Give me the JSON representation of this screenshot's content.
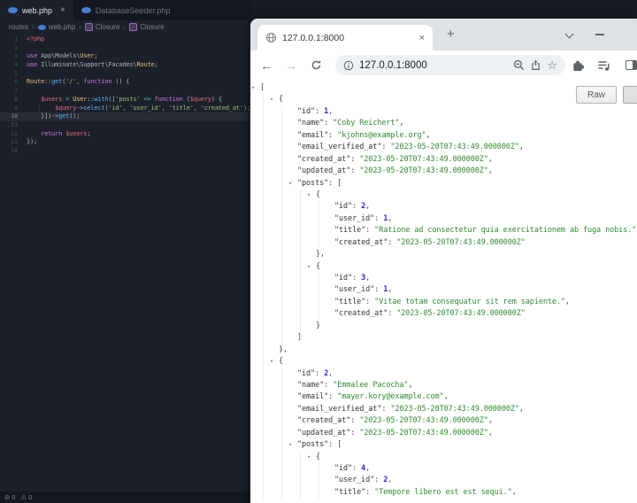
{
  "icons": {
    "close": "×",
    "plus": "+",
    "back": "←",
    "forward": "→",
    "star": "☆",
    "expander": "▾",
    "crumb_sep": "›",
    "error": "⊘",
    "warning": "⚠"
  },
  "editor": {
    "tabs": [
      {
        "label": "web.php"
      },
      {
        "label": "DatabaseSeeder.php"
      }
    ],
    "breadcrumb": [
      "routes",
      "web.php",
      "Closure",
      "Closure"
    ],
    "status": {
      "errors": "0",
      "warnings": "0"
    },
    "code_lines": [
      {
        "n": 1,
        "segs": [
          [
            "red",
            "<?php"
          ]
        ]
      },
      {
        "n": 2,
        "segs": []
      },
      {
        "n": 3,
        "segs": [
          [
            "purple",
            "use "
          ],
          [
            "fg",
            "App\\Models\\"
          ],
          [
            "yellow",
            "User"
          ],
          [
            "fg",
            ";"
          ]
        ]
      },
      {
        "n": 4,
        "segs": [
          [
            "purple",
            "use "
          ],
          [
            "fg",
            "Illuminate\\Support\\Facades\\"
          ],
          [
            "yellow",
            "Route"
          ],
          [
            "fg",
            ";"
          ]
        ]
      },
      {
        "n": 5,
        "segs": []
      },
      {
        "n": 6,
        "segs": [
          [
            "yellow",
            "Route"
          ],
          [
            "fg",
            "::"
          ],
          [
            "blue",
            "get"
          ],
          [
            "fg",
            "("
          ],
          [
            "green",
            "'/'"
          ],
          [
            "fg",
            ", "
          ],
          [
            "purple",
            "function"
          ],
          [
            "fg",
            " () {"
          ]
        ]
      },
      {
        "n": 7,
        "segs": []
      },
      {
        "n": 8,
        "segs": [
          [
            "fg",
            "    "
          ],
          [
            "red",
            "$users"
          ],
          [
            "fg",
            " "
          ],
          [
            "cyan",
            "="
          ],
          [
            "fg",
            " "
          ],
          [
            "yellow",
            "User"
          ],
          [
            "fg",
            "::"
          ],
          [
            "blue",
            "with"
          ],
          [
            "fg",
            "(["
          ],
          [
            "green",
            "'posts'"
          ],
          [
            "fg",
            " "
          ],
          [
            "cyan",
            "=>"
          ],
          [
            "fg",
            " "
          ],
          [
            "purple",
            "function"
          ],
          [
            "fg",
            " ("
          ],
          [
            "red",
            "$query"
          ],
          [
            "fg",
            ") {"
          ]
        ]
      },
      {
        "n": 9,
        "guide": true,
        "segs": [
          [
            "fg",
            "        "
          ],
          [
            "red",
            "$query"
          ],
          [
            "fg",
            "->"
          ],
          [
            "blue",
            "select"
          ],
          [
            "fg",
            "("
          ],
          [
            "green",
            "'id'"
          ],
          [
            "fg",
            ", "
          ],
          [
            "green",
            "'user_id'"
          ],
          [
            "fg",
            ", "
          ],
          [
            "green",
            "'title'"
          ],
          [
            "fg",
            ", "
          ],
          [
            "green",
            "'created_at'"
          ],
          [
            "fg",
            ");"
          ]
        ]
      },
      {
        "n": 10,
        "active": true,
        "segs": [
          [
            "fg",
            "    }])->"
          ],
          [
            "blue",
            "get"
          ],
          [
            "fg",
            "();"
          ]
        ]
      },
      {
        "n": 11,
        "segs": []
      },
      {
        "n": 12,
        "segs": [
          [
            "fg",
            "    "
          ],
          [
            "purple",
            "return "
          ],
          [
            "red",
            "$users"
          ],
          [
            "fg",
            ";"
          ]
        ]
      },
      {
        "n": 13,
        "segs": [
          [
            "fg",
            "});"
          ]
        ]
      },
      {
        "n": 14,
        "segs": []
      }
    ]
  },
  "browser": {
    "tab_title": "127.0.0.1:8000",
    "url": "127.0.0.1:8000",
    "raw_button": "Raw",
    "json_lines": [
      {
        "ind": 0,
        "exp": true,
        "segs": [
          [
            "p",
            "["
          ]
        ]
      },
      {
        "ind": 1,
        "exp": true,
        "segs": [
          [
            "p",
            "{"
          ]
        ]
      },
      {
        "ind": 2,
        "segs": [
          [
            "k",
            "\"id\""
          ],
          [
            "p",
            ": "
          ],
          [
            "n",
            "1"
          ],
          [
            "p",
            ","
          ]
        ]
      },
      {
        "ind": 2,
        "segs": [
          [
            "k",
            "\"name\""
          ],
          [
            "p",
            ": "
          ],
          [
            "s",
            "\"Coby Reichert\""
          ],
          [
            "p",
            ","
          ]
        ]
      },
      {
        "ind": 2,
        "segs": [
          [
            "k",
            "\"email\""
          ],
          [
            "p",
            ": "
          ],
          [
            "s",
            "\"kjohns@example.org\""
          ],
          [
            "p",
            ","
          ]
        ]
      },
      {
        "ind": 2,
        "segs": [
          [
            "k",
            "\"email_verified_at\""
          ],
          [
            "p",
            ": "
          ],
          [
            "s",
            "\"2023-05-20T07:43:49.000000Z\""
          ],
          [
            "p",
            ","
          ]
        ]
      },
      {
        "ind": 2,
        "segs": [
          [
            "k",
            "\"created_at\""
          ],
          [
            "p",
            ": "
          ],
          [
            "s",
            "\"2023-05-20T07:43:49.000000Z\""
          ],
          [
            "p",
            ","
          ]
        ]
      },
      {
        "ind": 2,
        "segs": [
          [
            "k",
            "\"updated_at\""
          ],
          [
            "p",
            ": "
          ],
          [
            "s",
            "\"2023-05-20T07:43:49.000000Z\""
          ],
          [
            "p",
            ","
          ]
        ]
      },
      {
        "ind": 2,
        "exp": true,
        "segs": [
          [
            "k",
            "\"posts\""
          ],
          [
            "p",
            ": ["
          ]
        ]
      },
      {
        "ind": 3,
        "exp": true,
        "segs": [
          [
            "p",
            "{"
          ]
        ]
      },
      {
        "ind": 4,
        "segs": [
          [
            "k",
            "\"id\""
          ],
          [
            "p",
            ": "
          ],
          [
            "n",
            "2"
          ],
          [
            "p",
            ","
          ]
        ]
      },
      {
        "ind": 4,
        "segs": [
          [
            "k",
            "\"user_id\""
          ],
          [
            "p",
            ": "
          ],
          [
            "n",
            "1"
          ],
          [
            "p",
            ","
          ]
        ]
      },
      {
        "ind": 4,
        "segs": [
          [
            "k",
            "\"title\""
          ],
          [
            "p",
            ": "
          ],
          [
            "s",
            "\"Ratione ad consectetur quia exercitationem ab fuga nobis.\""
          ],
          [
            "p",
            ","
          ]
        ]
      },
      {
        "ind": 4,
        "segs": [
          [
            "k",
            "\"created_at\""
          ],
          [
            "p",
            ": "
          ],
          [
            "s",
            "\"2023-05-20T07:43:49.000000Z\""
          ]
        ]
      },
      {
        "ind": 3,
        "segs": [
          [
            "p",
            "},"
          ]
        ]
      },
      {
        "ind": 3,
        "exp": true,
        "segs": [
          [
            "p",
            "{"
          ]
        ]
      },
      {
        "ind": 4,
        "segs": [
          [
            "k",
            "\"id\""
          ],
          [
            "p",
            ": "
          ],
          [
            "n",
            "3"
          ],
          [
            "p",
            ","
          ]
        ]
      },
      {
        "ind": 4,
        "segs": [
          [
            "k",
            "\"user_id\""
          ],
          [
            "p",
            ": "
          ],
          [
            "n",
            "1"
          ],
          [
            "p",
            ","
          ]
        ]
      },
      {
        "ind": 4,
        "segs": [
          [
            "k",
            "\"title\""
          ],
          [
            "p",
            ": "
          ],
          [
            "s",
            "\"Vitae totam consequatur sit rem sapiente.\""
          ],
          [
            "p",
            ","
          ]
        ]
      },
      {
        "ind": 4,
        "segs": [
          [
            "k",
            "\"created_at\""
          ],
          [
            "p",
            ": "
          ],
          [
            "s",
            "\"2023-05-20T07:43:49.000000Z\""
          ]
        ]
      },
      {
        "ind": 3,
        "segs": [
          [
            "p",
            "}"
          ]
        ]
      },
      {
        "ind": 2,
        "segs": [
          [
            "p",
            "]"
          ]
        ]
      },
      {
        "ind": 1,
        "segs": [
          [
            "p",
            "},"
          ]
        ]
      },
      {
        "ind": 1,
        "exp": true,
        "segs": [
          [
            "p",
            "{"
          ]
        ]
      },
      {
        "ind": 2,
        "segs": [
          [
            "k",
            "\"id\""
          ],
          [
            "p",
            ": "
          ],
          [
            "n",
            "2"
          ],
          [
            "p",
            ","
          ]
        ]
      },
      {
        "ind": 2,
        "segs": [
          [
            "k",
            "\"name\""
          ],
          [
            "p",
            ": "
          ],
          [
            "s",
            "\"Emmalee Pacocha\""
          ],
          [
            "p",
            ","
          ]
        ]
      },
      {
        "ind": 2,
        "segs": [
          [
            "k",
            "\"email\""
          ],
          [
            "p",
            ": "
          ],
          [
            "s",
            "\"mayer.kory@example.com\""
          ],
          [
            "p",
            ","
          ]
        ]
      },
      {
        "ind": 2,
        "segs": [
          [
            "k",
            "\"email_verified_at\""
          ],
          [
            "p",
            ": "
          ],
          [
            "s",
            "\"2023-05-20T07:43:49.000000Z\""
          ],
          [
            "p",
            ","
          ]
        ]
      },
      {
        "ind": 2,
        "segs": [
          [
            "k",
            "\"created_at\""
          ],
          [
            "p",
            ": "
          ],
          [
            "s",
            "\"2023-05-20T07:43:49.000000Z\""
          ],
          [
            "p",
            ","
          ]
        ]
      },
      {
        "ind": 2,
        "segs": [
          [
            "k",
            "\"updated_at\""
          ],
          [
            "p",
            ": "
          ],
          [
            "s",
            "\"2023-05-20T07:43:49.000000Z\""
          ],
          [
            "p",
            ","
          ]
        ]
      },
      {
        "ind": 2,
        "exp": true,
        "segs": [
          [
            "k",
            "\"posts\""
          ],
          [
            "p",
            ": ["
          ]
        ]
      },
      {
        "ind": 3,
        "exp": true,
        "segs": [
          [
            "p",
            "{"
          ]
        ]
      },
      {
        "ind": 4,
        "segs": [
          [
            "k",
            "\"id\""
          ],
          [
            "p",
            ": "
          ],
          [
            "n",
            "4"
          ],
          [
            "p",
            ","
          ]
        ]
      },
      {
        "ind": 4,
        "segs": [
          [
            "k",
            "\"user_id\""
          ],
          [
            "p",
            ": "
          ],
          [
            "n",
            "2"
          ],
          [
            "p",
            ","
          ]
        ]
      },
      {
        "ind": 4,
        "segs": [
          [
            "k",
            "\"title\""
          ],
          [
            "p",
            ": "
          ],
          [
            "s",
            "\"Tempore libero est est sequi.\""
          ],
          [
            "p",
            ","
          ]
        ]
      }
    ]
  }
}
